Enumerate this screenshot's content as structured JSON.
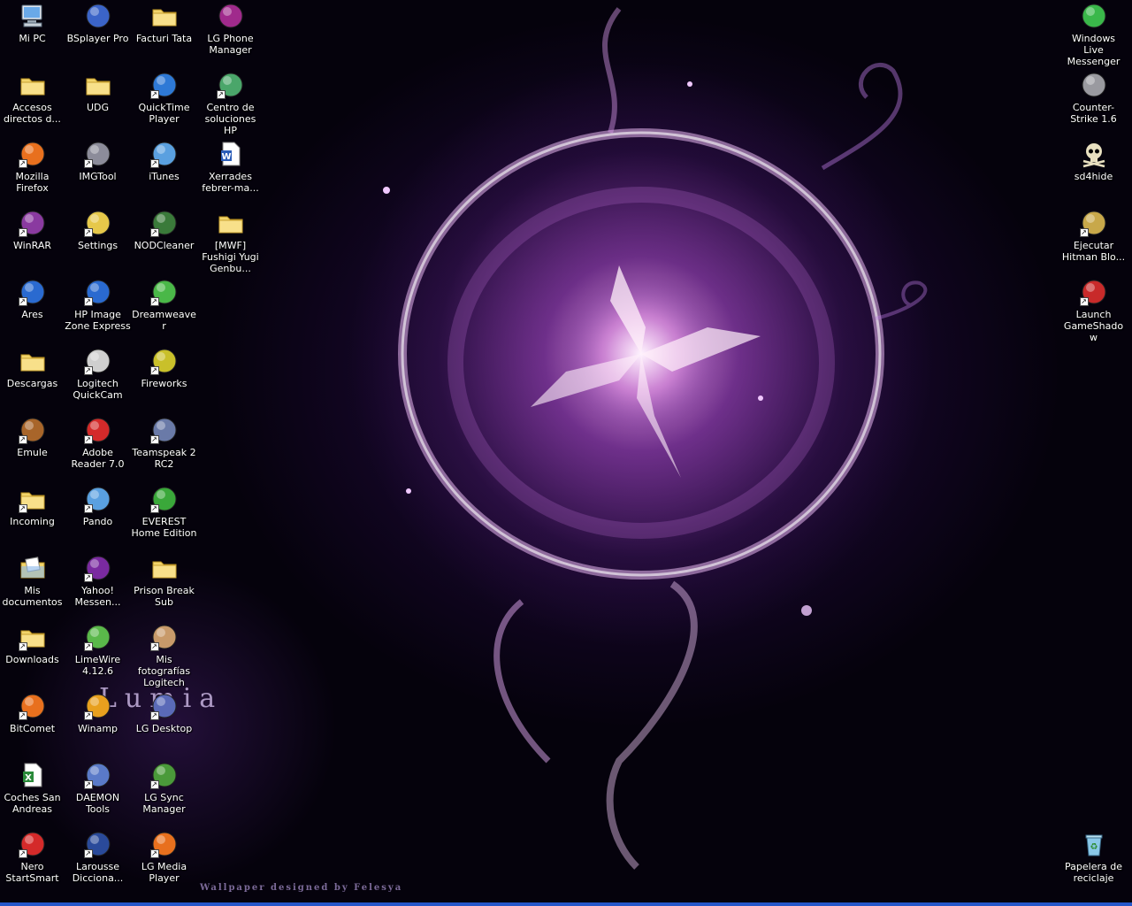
{
  "desktop": {
    "wallpaper_title": "Lumia",
    "wallpaper_credit": "Wallpaper designed by Felesya",
    "icons": [
      {
        "label": "Mi PC",
        "icon": "my-computer-icon",
        "shortcut": false,
        "color": "#6aa9e8"
      },
      {
        "label": "BSplayer Pro",
        "icon": "bsplayer-icon",
        "shortcut": false,
        "color": "#3b64c8"
      },
      {
        "label": "Facturi Tata",
        "icon": "folder-icon",
        "shortcut": false,
        "color": "#f2d46b"
      },
      {
        "label": "LG Phone Manager",
        "icon": "lg-phone-icon",
        "shortcut": false,
        "color": "#a02a8c"
      },
      {
        "label": "Accesos directos d...",
        "icon": "folder-icon",
        "shortcut": false,
        "color": "#f2d46b"
      },
      {
        "label": "UDG",
        "icon": "folder-icon",
        "shortcut": false,
        "color": "#f2d46b"
      },
      {
        "label": "QuickTime Player",
        "icon": "quicktime-icon",
        "shortcut": true,
        "color": "#2e79d6"
      },
      {
        "label": "Centro de soluciones HP",
        "icon": "hp-solutions-icon",
        "shortcut": true,
        "color": "#4aa66a"
      },
      {
        "label": "Mozilla Firefox",
        "icon": "firefox-icon",
        "shortcut": true,
        "color": "#e8701e"
      },
      {
        "label": "IMGTool",
        "icon": "imgtool-icon",
        "shortcut": true,
        "color": "#8c8c9a"
      },
      {
        "label": "iTunes",
        "icon": "itunes-icon",
        "shortcut": true,
        "color": "#5aa0e0"
      },
      {
        "label": "Xerrades febrer-ma...",
        "icon": "word-document-icon",
        "shortcut": false,
        "color": "#2b5db8"
      },
      {
        "label": "WinRAR",
        "icon": "winrar-icon",
        "shortcut": true,
        "color": "#8a3aa0"
      },
      {
        "label": "Settings",
        "icon": "settings-icon",
        "shortcut": true,
        "color": "#e6c84a"
      },
      {
        "label": "NODCleaner",
        "icon": "nodcleaner-icon",
        "shortcut": true,
        "color": "#3a7a3a"
      },
      {
        "label": "[MWF] Fushigi Yugi Genbu...",
        "icon": "folder-icon",
        "shortcut": false,
        "color": "#f2d46b"
      },
      {
        "label": "Ares",
        "icon": "ares-icon",
        "shortcut": true,
        "color": "#2a6ad0"
      },
      {
        "label": "HP Image Zone Express",
        "icon": "hp-image-zone-icon",
        "shortcut": true,
        "color": "#2a6ad0"
      },
      {
        "label": "Dreamweaver",
        "icon": "dreamweaver-icon",
        "shortcut": true,
        "color": "#4ab848"
      },
      {
        "label": "Descargas",
        "icon": "folder-icon",
        "shortcut": false,
        "color": "#f2d46b"
      },
      {
        "label": "Logitech QuickCam",
        "icon": "webcam-icon",
        "shortcut": true,
        "color": "#cfcfcf"
      },
      {
        "label": "Fireworks",
        "icon": "fireworks-icon",
        "shortcut": true,
        "color": "#c9c02a"
      },
      {
        "label": "Emule",
        "icon": "emule-icon",
        "shortcut": true,
        "color": "#a8652a"
      },
      {
        "label": "Adobe Reader 7.0",
        "icon": "adobe-reader-icon",
        "shortcut": true,
        "color": "#d42a2a"
      },
      {
        "label": "Teamspeak 2 RC2",
        "icon": "teamspeak-icon",
        "shortcut": true,
        "color": "#6a7aa8"
      },
      {
        "label": "Incoming",
        "icon": "folder-icon",
        "shortcut": true,
        "color": "#f2d46b"
      },
      {
        "label": "Pando",
        "icon": "pando-icon",
        "shortcut": true,
        "color": "#5aa0e0"
      },
      {
        "label": "EVEREST Home Edition",
        "icon": "everest-icon",
        "shortcut": true,
        "color": "#3aa83a"
      },
      {
        "label": "Mis documentos",
        "icon": "my-documents-icon",
        "shortcut": false,
        "color": "#f2d46b"
      },
      {
        "label": "Yahoo! Messen...",
        "icon": "yahoo-messenger-icon",
        "shortcut": true,
        "color": "#7a2aa0"
      },
      {
        "label": "Prison Break Sub",
        "icon": "folder-icon",
        "shortcut": false,
        "color": "#f2d46b"
      },
      {
        "label": "Downloads",
        "icon": "folder-icon",
        "shortcut": true,
        "color": "#f2d46b"
      },
      {
        "label": "LimeWire 4.12.6",
        "icon": "limewire-icon",
        "shortcut": true,
        "color": "#5ab84a"
      },
      {
        "label": "Mis fotografías Logitech",
        "icon": "photo-album-icon",
        "shortcut": true,
        "color": "#c89a6a"
      },
      {
        "label": "BitComet",
        "icon": "bitcomet-icon",
        "shortcut": true,
        "color": "#e8701e"
      },
      {
        "label": "Winamp",
        "icon": "winamp-icon",
        "shortcut": true,
        "color": "#e8a01e"
      },
      {
        "label": "LG Desktop",
        "icon": "lg-desktop-icon",
        "shortcut": true,
        "color": "#5a6ab8"
      },
      {
        "label": "Coches San Andreas",
        "icon": "excel-document-icon",
        "shortcut": false,
        "color": "#2a8a3a"
      },
      {
        "label": "DAEMON Tools",
        "icon": "daemon-tools-icon",
        "shortcut": true,
        "color": "#5a7ac8"
      },
      {
        "label": "LG Sync Manager",
        "icon": "lg-sync-icon",
        "shortcut": true,
        "color": "#4a9a3a"
      },
      {
        "label": "Nero StartSmart",
        "icon": "nero-icon",
        "shortcut": true,
        "color": "#d42a2a"
      },
      {
        "label": "Larousse Dicciona...",
        "icon": "larousse-icon",
        "shortcut": true,
        "color": "#2a4a9a"
      },
      {
        "label": "LG Media Player",
        "icon": "lg-media-player-icon",
        "shortcut": true,
        "color": "#e8701e"
      },
      {
        "label": "Windows Live Messenger",
        "icon": "windows-live-messenger-icon",
        "shortcut": false,
        "color": "#3ab84a"
      },
      {
        "label": "Counter-Strike 1.6",
        "icon": "counter-strike-icon",
        "shortcut": false,
        "color": "#9a9aa0"
      },
      {
        "label": "sd4hide",
        "icon": "skull-icon",
        "shortcut": false,
        "color": "#e8e0c0"
      },
      {
        "label": "Ejecutar Hitman Blo...",
        "icon": "hitman-icon",
        "shortcut": true,
        "color": "#c8a84a"
      },
      {
        "label": "Launch GameShadow",
        "icon": "gameshadow-icon",
        "shortcut": true,
        "color": "#c82a2a"
      },
      {
        "label": "Papelera de reciclaje",
        "icon": "recycle-bin-icon",
        "shortcut": false,
        "color": "#8ac8e8"
      }
    ]
  }
}
